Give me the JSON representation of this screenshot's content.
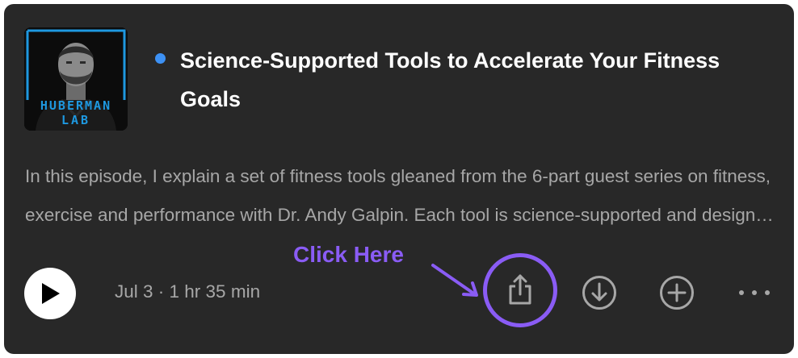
{
  "episode": {
    "title": "Science-Supported Tools to Accelerate Your Fitness Goals",
    "description": "In this episode, I explain a set of fitness tools gleaned from the 6-part guest series on fitness, exercise and performance with Dr. Andy Galpin. Each tool is science-supported and designed to help you achieve your fitness goals.",
    "meta": "Jul 3 · 1 hr 35 min",
    "is_new": true
  },
  "cover": {
    "line1": "HUBERMAN",
    "line2": "LAB",
    "accent_color": "#1e98e0"
  },
  "controls": {
    "play_icon": "play-icon",
    "share_icon": "share-icon",
    "download_icon": "download-circle-icon",
    "add_icon": "add-circle-icon",
    "more_icon": "more-horizontal-icon"
  },
  "annotation": {
    "label": "Click Here",
    "color": "#8a5cf5"
  },
  "colors": {
    "card_background": "#282828",
    "new_dot": "#3d91f4",
    "secondary_text": "#a7a7a7"
  }
}
